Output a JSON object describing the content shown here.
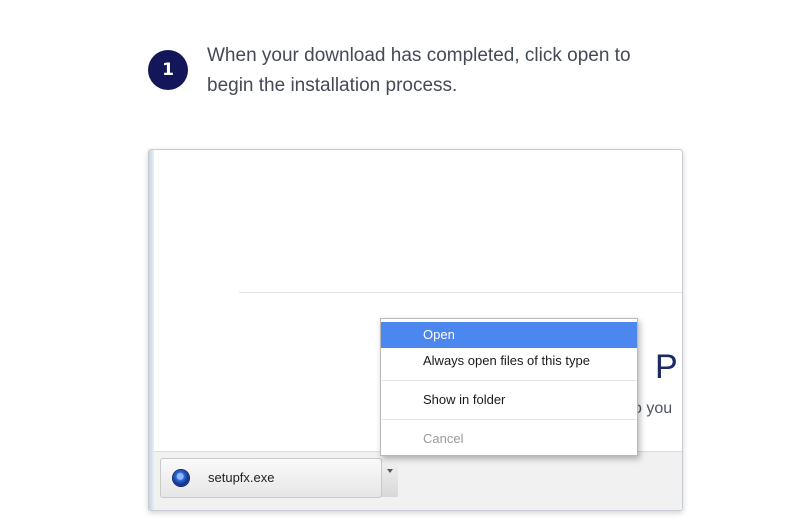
{
  "step": {
    "number": "1",
    "text": "When your download has completed, click open to begin the installation process."
  },
  "browser": {
    "page_heading_fragment": "P",
    "page_sub_fragment": "o you",
    "download": {
      "file_name": "setupfx.exe",
      "icon": "blue-orb-icon"
    },
    "context_menu": {
      "items": [
        {
          "label": "Open",
          "state": "selected"
        },
        {
          "label": "Always open files of this type",
          "state": "normal"
        },
        {
          "label": "Show in folder",
          "state": "normal"
        },
        {
          "label": "Cancel",
          "state": "disabled"
        }
      ]
    }
  },
  "colors": {
    "badge": "#13175a",
    "menu_highlight": "#4b87ee",
    "heading": "#1c2a63"
  }
}
